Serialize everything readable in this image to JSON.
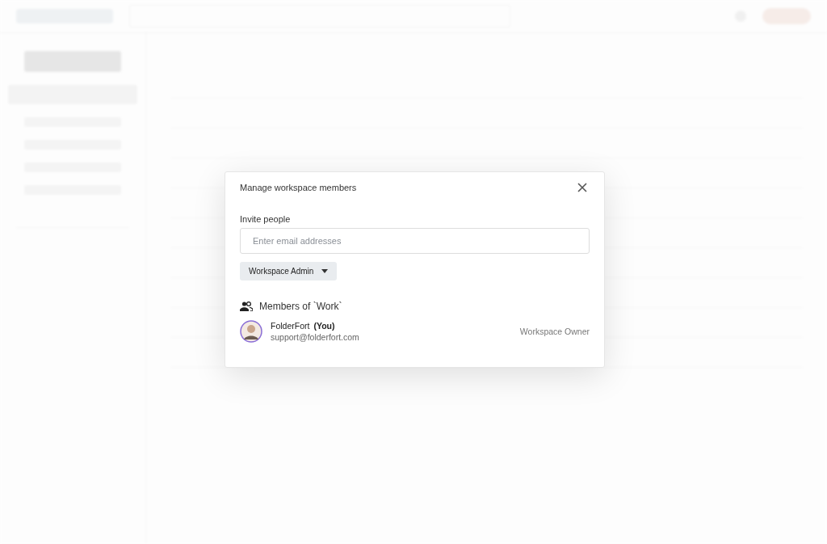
{
  "dialog": {
    "title": "Manage workspace members",
    "invite_label": "Invite people",
    "email_field": {
      "placeholder": "Enter email addresses"
    },
    "role_dropdown": {
      "label": "Workspace Admin"
    },
    "members_heading": "Members of `Work`",
    "members": [
      {
        "name": "FolderFort",
        "tag": "(You)",
        "email": "support@folderfort.com",
        "role": "Workspace Owner"
      }
    ]
  }
}
